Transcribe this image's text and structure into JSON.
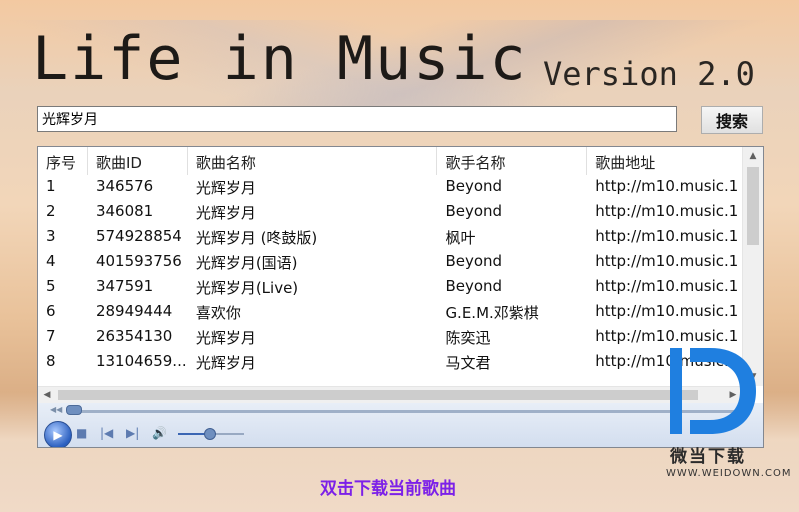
{
  "app": {
    "title": "Life in Music",
    "version": "Version 2.0"
  },
  "search": {
    "value": "光辉岁月",
    "button_label": "搜索"
  },
  "table": {
    "columns": [
      "序号",
      "歌曲ID",
      "歌曲名称",
      "歌手名称",
      "歌曲地址"
    ],
    "rows": [
      [
        "1",
        "346576",
        "光辉岁月",
        "Beyond",
        "http://m10.music.1"
      ],
      [
        "2",
        "346081",
        "光辉岁月",
        "Beyond",
        "http://m10.music.1"
      ],
      [
        "3",
        "574928854",
        "光辉岁月 (咚鼓版)",
        "枫叶",
        "http://m10.music.1"
      ],
      [
        "4",
        "401593756",
        "光辉岁月(国语)",
        "Beyond",
        "http://m10.music.1"
      ],
      [
        "5",
        "347591",
        "光辉岁月(Live)",
        "Beyond",
        "http://m10.music.1"
      ],
      [
        "6",
        "28949444",
        "喜欢你",
        "G.E.M.邓紫棋",
        "http://m10.music.1"
      ],
      [
        "7",
        "26354130",
        "光辉岁月",
        "陈奕迅",
        "http://m10.music.1"
      ],
      [
        "8",
        "13104659...",
        "光辉岁月",
        "马文君",
        "http://m10.music.1"
      ]
    ]
  },
  "player": {
    "play_icon": "play-icon",
    "stop_icon": "stop-icon",
    "prev_icon": "previous-icon",
    "next_icon": "next-icon",
    "volume_icon": "volume-icon",
    "seek_position": 0.0,
    "volume_level": 0.5
  },
  "hint": "双击下载当前歌曲",
  "watermark": {
    "name": "微当下载",
    "url": "WWW.WEIDOWN.COM"
  },
  "colors": {
    "hint": "#7c20e8",
    "brand_blue": "#1f7fe0"
  }
}
